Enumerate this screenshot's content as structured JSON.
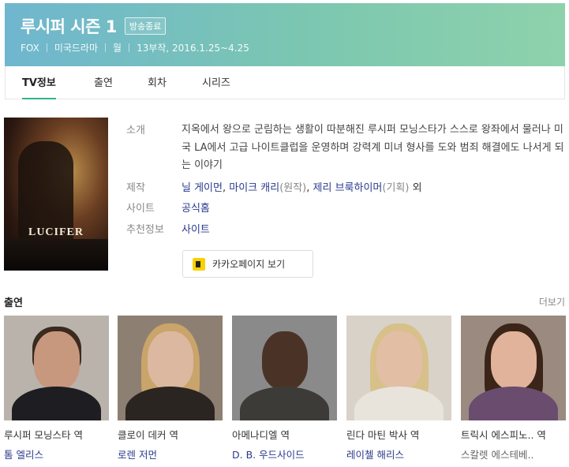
{
  "header": {
    "title": "루시퍼 시즌 1",
    "badge": "방송종료",
    "channel": "FOX",
    "genre": "미국드라마",
    "day": "월",
    "episodes_dates": "13부작, 2016.1.25~4.25"
  },
  "tabs": [
    {
      "label": "TV정보",
      "active": true
    },
    {
      "label": "출연"
    },
    {
      "label": "회차"
    },
    {
      "label": "시리즈"
    }
  ],
  "poster": {
    "title": "LUCIFER"
  },
  "info": {
    "intro_label": "소개",
    "intro_text": "지옥에서 왕으로 군림하는 생활이 따분해진 루시퍼 모닝스타가 스스로 왕좌에서 물러나 미국 LA에서 고급 나이트클럽을 운영하며 강력계 미녀 형사를 도와 범죄 해결에도 나서게 되는 이야기",
    "production_label": "제작",
    "production": {
      "person1": "닐 게이먼",
      "person2": "마이크 캐리",
      "role2": "(원작)",
      "person3": "제리 브룩하이머",
      "role3": "(기획)",
      "suffix": "외"
    },
    "site_label": "사이트",
    "site_value": "공식홈",
    "recommend_label": "추천정보",
    "recommend_value": "사이트"
  },
  "kakao_button": {
    "label": "카카오페이지 보기"
  },
  "cast": {
    "title": "출연",
    "more": "더보기",
    "members": [
      {
        "role": "루시퍼 모닝스타 역",
        "actor": "톰 엘리스"
      },
      {
        "role": "클로이 데커 역",
        "actor": "로렌 저먼"
      },
      {
        "role": "아메나디엘 역",
        "actor": "D. B. 우드사이드"
      },
      {
        "role": "린다 마틴 박사 역",
        "actor": "레이첼 해리스"
      },
      {
        "role": "트릭시 에스피노.. 역",
        "actor": "스칼렛 에스테베.."
      }
    ]
  },
  "colors": {
    "header_start": "#6fb6cf",
    "header_end": "#8ed2ac",
    "tab_active": "#2fb58a",
    "link": "#2a3a8c",
    "kakao": "#fad100"
  }
}
